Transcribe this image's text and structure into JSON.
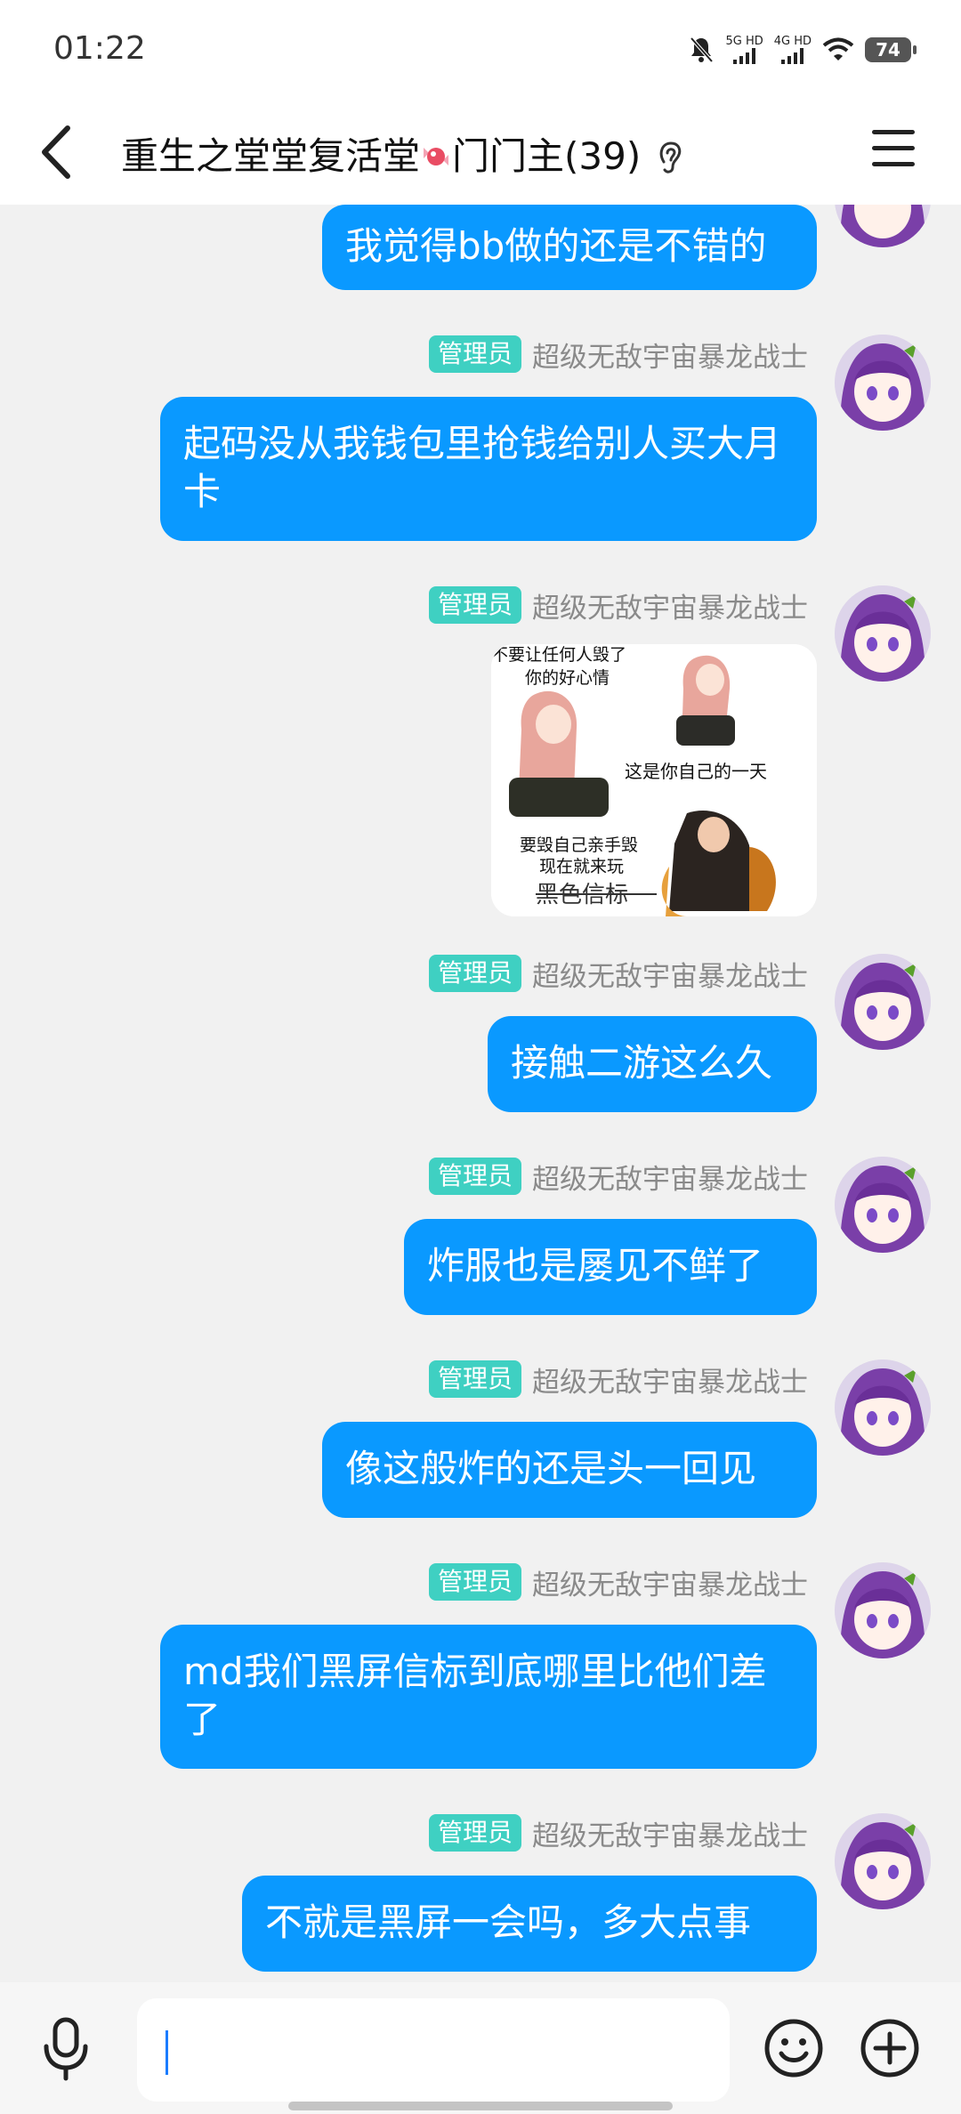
{
  "status": {
    "time": "01:22",
    "net1": "5G HD",
    "net2": "4G HD",
    "battery": "74"
  },
  "header": {
    "title_prefix": "重生之堂堂复活堂",
    "title_suffix": "门门主(39)"
  },
  "messages": [
    {
      "text": "我觉得bb做的还是不错的"
    },
    {
      "badge": "管理员",
      "sender": "超级无敌宇宙暴龙战士",
      "text": "起码没从我钱包里抢钱给别人买大月卡"
    },
    {
      "badge": "管理员",
      "sender": "超级无敌宇宙暴龙战士",
      "image": {
        "cap1": "不要让任何人毁了你的好心情",
        "cap2": "这是你自己的一天",
        "cap3": "要毁自己亲手毁现在就来玩",
        "cap4": "黑色信标"
      }
    },
    {
      "badge": "管理员",
      "sender": "超级无敌宇宙暴龙战士",
      "text": "接触二游这么久"
    },
    {
      "badge": "管理员",
      "sender": "超级无敌宇宙暴龙战士",
      "text": "炸服也是屡见不鲜了"
    },
    {
      "badge": "管理员",
      "sender": "超级无敌宇宙暴龙战士",
      "text": "像这般炸的还是头一回见"
    },
    {
      "badge": "管理员",
      "sender": "超级无敌宇宙暴龙战士",
      "text": "md我们黑屏信标到底哪里比他们差了"
    },
    {
      "badge": "管理员",
      "sender": "超级无敌宇宙暴龙战士",
      "text": "不就是黑屏一会吗，多大点事"
    }
  ],
  "input": {
    "value": "",
    "placeholder": ""
  },
  "colors": {
    "bubble": "#0a99ff",
    "badge": "#3fd0c2",
    "background": "#f1f1f1"
  },
  "icons": [
    "back-arrow-icon",
    "candy-icon",
    "ear-icon",
    "menu-icon",
    "mic-icon",
    "emoji-icon",
    "plus-icon"
  ]
}
